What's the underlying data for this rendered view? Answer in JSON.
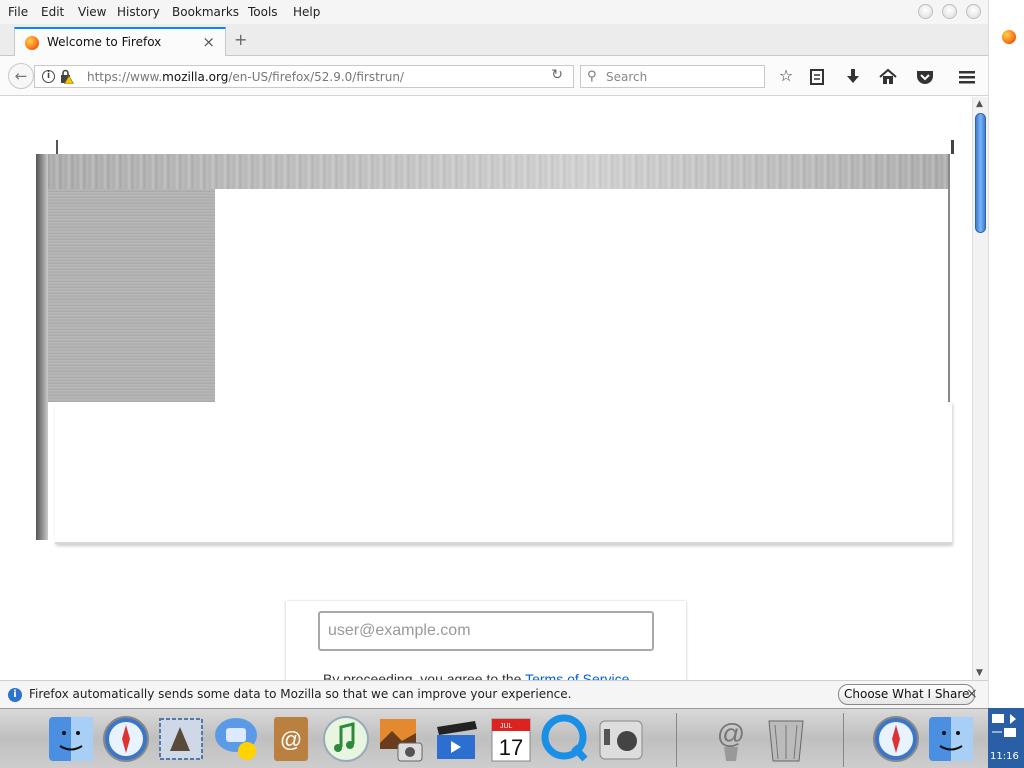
{
  "menu": {
    "file": "File",
    "edit": "Edit",
    "view": "View",
    "history": "History",
    "bookmarks": "Bookmarks",
    "tools": "Tools",
    "help": "Help"
  },
  "tab": {
    "title": "Welcome to Firefox",
    "close_glyph": "×",
    "new_tab_glyph": "+"
  },
  "navbar": {
    "url_prefix": "https://www.",
    "url_domain": "mozilla.org",
    "url_path": "/en-US/firefox/52.9.0/firstrun/",
    "search_placeholder": "Search"
  },
  "page": {
    "email_placeholder": "user@example.com",
    "proceed_text": "By proceeding, you agree to the ",
    "terms_link": "Terms of Service"
  },
  "notification": {
    "info_glyph": "i",
    "message": "Firefox automatically sends some data to Mozilla so that we can improve your experience.",
    "button_label": "Choose What I Share",
    "close_glyph": "×"
  },
  "clock": "11:16",
  "dock_icons": [
    "finder-icon",
    "safari-icon",
    "mail-icon",
    "ichat-icon",
    "address-book-icon",
    "itunes-icon",
    "iphoto-icon",
    "imovie-icon",
    "ical-icon",
    "quicktime-icon",
    "system-preferences-icon",
    "internet-connect-icon",
    "trash-icon",
    "safari-icon",
    "finder-icon"
  ],
  "ical_date": "17",
  "ical_month": "JUL"
}
